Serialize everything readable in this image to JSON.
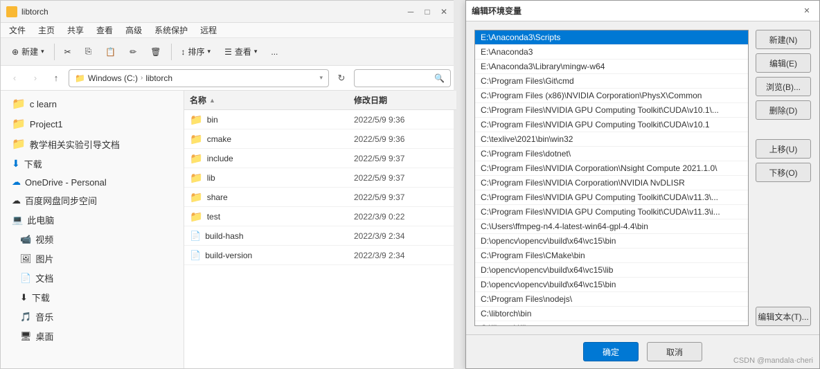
{
  "explorer": {
    "title": "libtorch",
    "menu": [
      "文件",
      "主页",
      "共享",
      "查看",
      "高级",
      "系统保护",
      "远程"
    ],
    "toolbar": {
      "new_label": "新建",
      "cut_label": "剪切",
      "copy_label": "复制",
      "paste_label": "粘贴",
      "rename_label": "重命名",
      "delete_label": "删除",
      "sort_label": "排序",
      "view_label": "查看",
      "more_label": "..."
    },
    "address": {
      "path": "Windows (C:) > libtorch",
      "part1": "Windows (C:)",
      "part2": "libtorch"
    },
    "sidebar": [
      {
        "label": "c learn",
        "type": "folder"
      },
      {
        "label": "Project1",
        "type": "folder"
      },
      {
        "label": "教学相关实验引导文档",
        "type": "folder"
      },
      {
        "label": "下载",
        "type": "download"
      },
      {
        "label": "OneDrive - Personal",
        "type": "onedrive"
      },
      {
        "label": "百度网盘同步空间",
        "type": "baidu"
      },
      {
        "label": "此电脑",
        "type": "pc"
      },
      {
        "label": "视频",
        "type": "video"
      },
      {
        "label": "图片",
        "type": "image"
      },
      {
        "label": "文档",
        "type": "doc"
      },
      {
        "label": "下载",
        "type": "download2"
      },
      {
        "label": "音乐",
        "type": "music"
      },
      {
        "label": "桌面",
        "type": "desktop"
      }
    ],
    "columns": {
      "name": "名称",
      "date": "修改日期"
    },
    "files": [
      {
        "name": "bin",
        "type": "folder",
        "date": "2022/5/9 9:36"
      },
      {
        "name": "cmake",
        "type": "folder",
        "date": "2022/5/9 9:36"
      },
      {
        "name": "include",
        "type": "folder",
        "date": "2022/5/9 9:37"
      },
      {
        "name": "lib",
        "type": "folder",
        "date": "2022/5/9 9:37"
      },
      {
        "name": "share",
        "type": "folder",
        "date": "2022/5/9 9:37"
      },
      {
        "name": "test",
        "type": "folder",
        "date": "2022/3/9 0:22"
      },
      {
        "name": "build-hash",
        "type": "file",
        "date": "2022/3/9 2:34"
      },
      {
        "name": "build-version",
        "type": "file",
        "date": "2022/3/9 2:34"
      }
    ]
  },
  "env_dialog": {
    "title": "编辑环境变量",
    "env_list": [
      "E:\\Anaconda3\\Scripts",
      "E:\\Anaconda3",
      "E:\\Anaconda3\\Library\\mingw-w64",
      "C:\\Program Files\\Git\\cmd",
      "C:\\Program Files (x86)\\NVIDIA Corporation\\PhysX\\Common",
      "C:\\Program Files\\NVIDIA GPU Computing Toolkit\\CUDA\\v10.1\\...",
      "C:\\Program Files\\NVIDIA GPU Computing Toolkit\\CUDA\\v10.1",
      "C:\\texlive\\2021\\bin\\win32",
      "C:\\Program Files\\dotnet\\",
      "C:\\Program Files\\NVIDIA Corporation\\Nsight Compute 2021.1.0\\",
      "C:\\Program Files\\NVIDIA Corporation\\NVIDIA NvDLISR",
      "C:\\Program Files\\NVIDIA GPU Computing Toolkit\\CUDA\\v11.3\\...",
      "C:\\Program Files\\NVIDIA GPU Computing Toolkit\\CUDA\\v11.3\\i...",
      "C:\\Users\\ffmpeg-n4.4-latest-win64-gpl-4.4\\bin",
      "D:\\opencv\\opencv\\build\\x64\\vc15\\bin",
      "C:\\Program Files\\CMake\\bin",
      "D:\\opencv\\opencv\\build\\x64\\vc15\\lib",
      "D:\\opencv\\opencv\\build\\x64\\vc15\\bin",
      "C:\\Program Files\\nodejs\\",
      "C:\\libtorch\\bin",
      "C:\\libtorch\\lib"
    ],
    "buttons": {
      "new": "新建(N)",
      "edit": "编辑(E)",
      "browse": "浏览(B)...",
      "delete": "删除(D)",
      "move_up": "上移(U)",
      "move_down": "下移(O)",
      "edit_text": "编辑文本(T)..."
    },
    "footer": {
      "ok": "确定",
      "cancel": "取消"
    }
  },
  "watermark": "CSDN @mandala·cheri"
}
